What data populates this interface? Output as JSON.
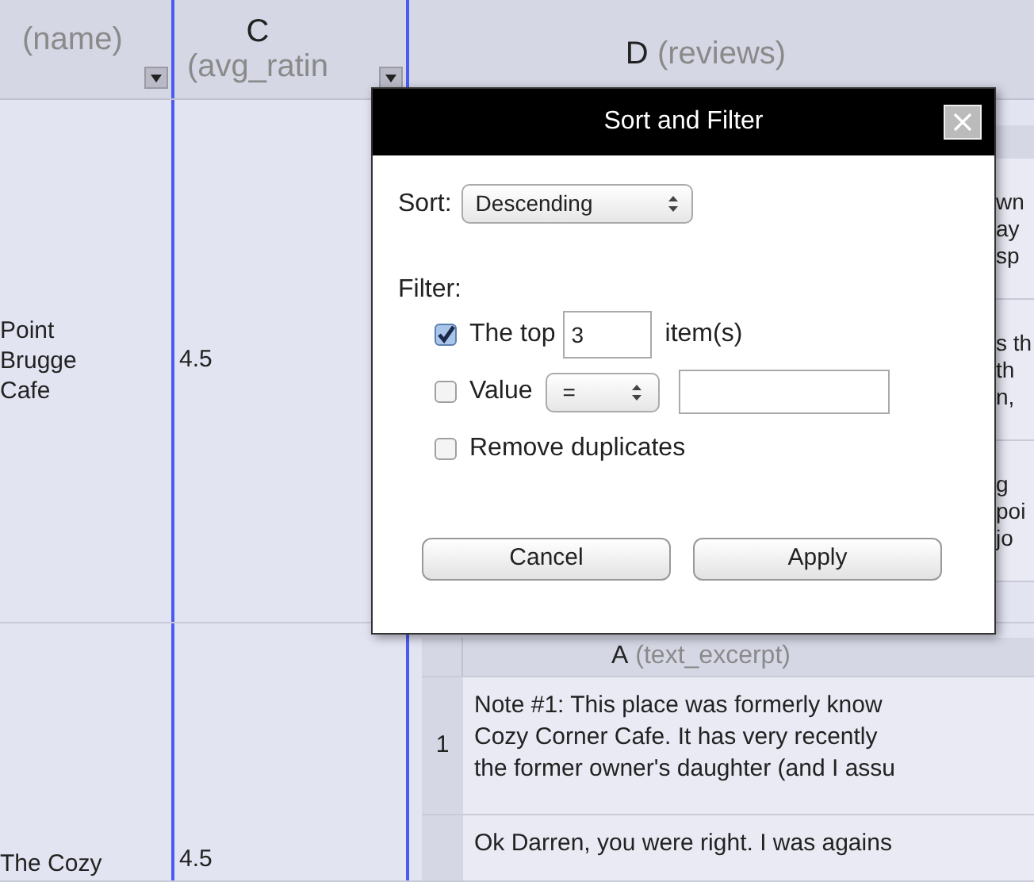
{
  "sheet": {
    "columns": [
      {
        "label": "(name)",
        "filter_button": true
      },
      {
        "letter": "C",
        "label": "(avg_ratin",
        "filter_button": true
      },
      {
        "letter": "D",
        "label": "(reviews)",
        "filter_button": false
      }
    ],
    "rows": [
      {
        "name": "Point Brugge Cafe",
        "rating": "4.5",
        "reviews": {
          "kind": "fragments",
          "cells": [
            [
              "wn",
              "ay",
              "sp"
            ],
            [
              "s th",
              "th",
              "n,"
            ],
            [
              "g",
              "poi",
              "jo"
            ]
          ]
        }
      },
      {
        "name": "The Cozy",
        "rating": "4.5",
        "reviews": {
          "kind": "table",
          "header": {
            "letter": "A",
            "label": "(text_excerpt)"
          },
          "rows": [
            {
              "number": "1",
              "lines": [
                "Note #1: This place was formerly know",
                "Cozy Corner Cafe. It has very recently",
                "the former owner's daughter (and I assu"
              ]
            },
            {
              "lines": [
                "Ok Darren, you were right. I was agains"
              ]
            }
          ]
        }
      }
    ]
  },
  "dialog": {
    "title": "Sort and Filter",
    "sort": {
      "label": "Sort:",
      "value": "Descending"
    },
    "filter": {
      "label": "Filter:",
      "options": [
        {
          "kind": "top",
          "checked": true,
          "label": "The top",
          "value": "3",
          "suffix": "item(s)"
        },
        {
          "kind": "value",
          "checked": false,
          "label": "Value",
          "operator": "="
        },
        {
          "kind": "plain",
          "checked": false,
          "label": "Remove duplicates"
        }
      ]
    },
    "buttons": [
      "Cancel",
      "Apply"
    ]
  }
}
